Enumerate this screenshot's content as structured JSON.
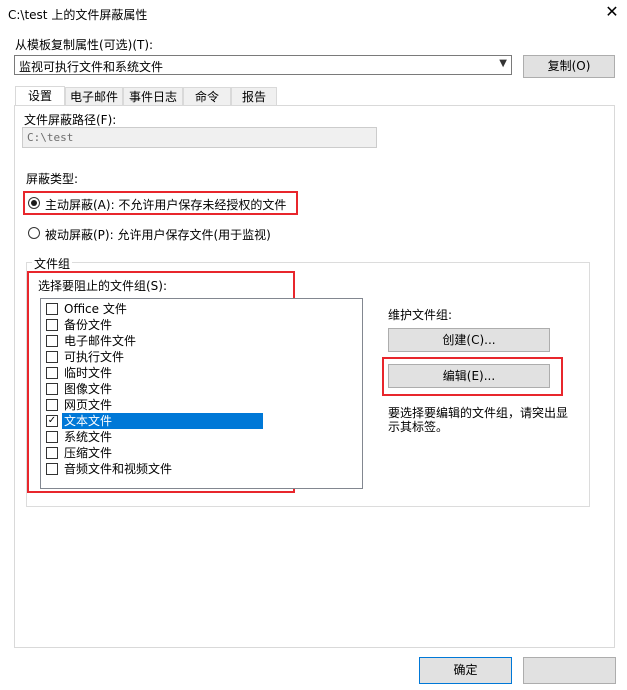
{
  "window": {
    "title": "C:\\test 上的文件屏蔽属性",
    "close_glyph": "✕"
  },
  "template": {
    "label": "从模板复制属性(可选)(T):",
    "selected": "监视可执行文件和系统文件",
    "copy_button": "复制(O)"
  },
  "tabs": [
    {
      "label": "设置",
      "active": true
    },
    {
      "label": "电子邮件"
    },
    {
      "label": "事件日志"
    },
    {
      "label": "命令"
    },
    {
      "label": "报告"
    }
  ],
  "settings": {
    "path_label": "文件屏蔽路径(F):",
    "path_value": "C:\\test",
    "screen_type_label": "屏蔽类型:",
    "active_option": "主动屏蔽(A): 不允许用户保存未经授权的文件",
    "passive_option": "被动屏蔽(P): 允许用户保存文件(用于监视)",
    "selected_type": "active"
  },
  "file_groups": {
    "group_title": "文件组",
    "list_label": "选择要阻止的文件组(S):",
    "items": [
      {
        "label": "Office 文件",
        "checked": false
      },
      {
        "label": "备份文件",
        "checked": false
      },
      {
        "label": "电子邮件文件",
        "checked": false
      },
      {
        "label": "可执行文件",
        "checked": false
      },
      {
        "label": "临时文件",
        "checked": false
      },
      {
        "label": "图像文件",
        "checked": false
      },
      {
        "label": "网页文件",
        "checked": false
      },
      {
        "label": "文本文件",
        "checked": true,
        "selected": true
      },
      {
        "label": "系统文件",
        "checked": false
      },
      {
        "label": "压缩文件",
        "checked": false
      },
      {
        "label": "音频文件和视频文件",
        "checked": false
      }
    ],
    "maintain_label": "维护文件组:",
    "create_button": "创建(C)...",
    "edit_button": "编辑(E)...",
    "hint": "要选择要编辑的文件组，请突出显示其标签。"
  },
  "footer": {
    "ok_button": "确定"
  },
  "colors": {
    "highlight_red": "#e8262c",
    "selection_blue": "#0078d7"
  }
}
